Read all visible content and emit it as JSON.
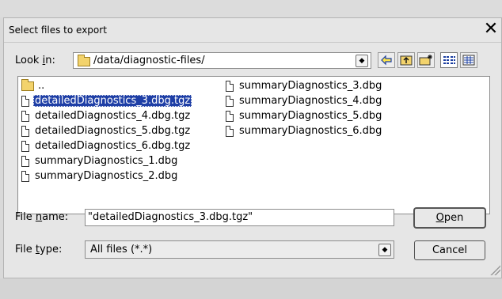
{
  "dialog": {
    "title": "Select files to export",
    "close_glyph": "✕"
  },
  "lookin": {
    "label_pre": "Look ",
    "label_ul": "i",
    "label_post": "n:",
    "path": "/data/diagnostic-files/"
  },
  "toolbar": {
    "icons": [
      "back-icon",
      "parent-folder-icon",
      "new-folder-icon",
      "list-view-icon",
      "detail-view-icon"
    ]
  },
  "files": {
    "col1": [
      {
        "name": "..",
        "type": "folder",
        "selected": false
      },
      {
        "name": "detailedDiagnostics_3.dbg.tgz",
        "type": "file",
        "selected": true
      },
      {
        "name": "detailedDiagnostics_4.dbg.tgz",
        "type": "file",
        "selected": false
      },
      {
        "name": "detailedDiagnostics_5.dbg.tgz",
        "type": "file",
        "selected": false
      },
      {
        "name": "detailedDiagnostics_6.dbg.tgz",
        "type": "file",
        "selected": false
      },
      {
        "name": "summaryDiagnostics_1.dbg",
        "type": "file",
        "selected": false
      },
      {
        "name": "summaryDiagnostics_2.dbg",
        "type": "file",
        "selected": false
      }
    ],
    "col2": [
      {
        "name": "summaryDiagnostics_3.dbg",
        "type": "file",
        "selected": false
      },
      {
        "name": "summaryDiagnostics_4.dbg",
        "type": "file",
        "selected": false
      },
      {
        "name": "summaryDiagnostics_5.dbg",
        "type": "file",
        "selected": false
      },
      {
        "name": "summaryDiagnostics_6.dbg",
        "type": "file",
        "selected": false
      }
    ]
  },
  "filename": {
    "label_pre": "File ",
    "label_ul": "n",
    "label_post": "ame:",
    "value": "\"detailedDiagnostics_3.dbg.tgz\""
  },
  "filetype": {
    "label_pre": "File ",
    "label_ul": "t",
    "label_post": "ype:",
    "value": "All files (*.*)"
  },
  "buttons": {
    "open_ul": "O",
    "open_rest": "pen",
    "cancel": "Cancel"
  },
  "colors": {
    "selection": "#1f3fa6",
    "background": "#e6e6e6"
  }
}
